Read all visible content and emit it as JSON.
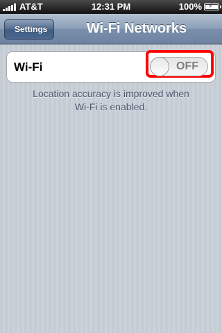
{
  "status_bar": {
    "carrier": "AT&T",
    "time": "12:31 PM",
    "battery_percent": "100%",
    "battery_level": 1.0,
    "signal_bars": 5,
    "icons": [
      "signal-bars-icon",
      "battery-charging-icon"
    ]
  },
  "nav": {
    "back_label": "Settings",
    "title": "Wi-Fi Networks"
  },
  "wifi": {
    "label": "Wi-Fi",
    "toggle_state": "OFF"
  },
  "footer": {
    "line1": "Location accuracy is improved when",
    "line2": "Wi-Fi is enabled."
  },
  "colors": {
    "highlight": "#ff0000",
    "nav_bar": "#7a8fab",
    "background": "#c5ccd4"
  }
}
